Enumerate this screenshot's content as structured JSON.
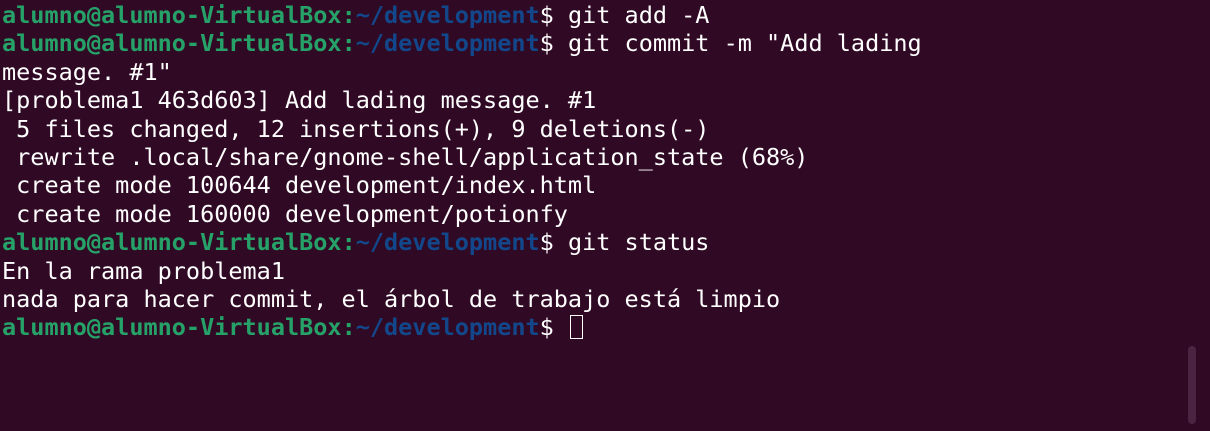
{
  "prompt": {
    "user": "alumno@alumno-VirtualBox",
    "colon": ":",
    "path": "~/development",
    "dollar": "$"
  },
  "lines": [
    {
      "type": "prompt",
      "command": " git add -A"
    },
    {
      "type": "prompt",
      "command": " git commit -m \"Add lading"
    },
    {
      "type": "output",
      "text": "message. #1\""
    },
    {
      "type": "output",
      "text": "[problema1 463d603] Add lading message. #1"
    },
    {
      "type": "output",
      "text": " 5 files changed, 12 insertions(+), 9 deletions(-)"
    },
    {
      "type": "output",
      "text": " rewrite .local/share/gnome-shell/application_state (68%)"
    },
    {
      "type": "output",
      "text": " create mode 100644 development/index.html"
    },
    {
      "type": "output",
      "text": " create mode 160000 development/potionfy"
    },
    {
      "type": "prompt",
      "command": " git status"
    },
    {
      "type": "output",
      "text": "En la rama problema1"
    },
    {
      "type": "output",
      "text": "nada para hacer commit, el árbol de trabajo está limpio"
    },
    {
      "type": "prompt",
      "command": " ",
      "cursor": true
    }
  ],
  "colors": {
    "background": "#300a24",
    "user": "#26a269",
    "path": "#12488b",
    "text": "#ffffff"
  }
}
